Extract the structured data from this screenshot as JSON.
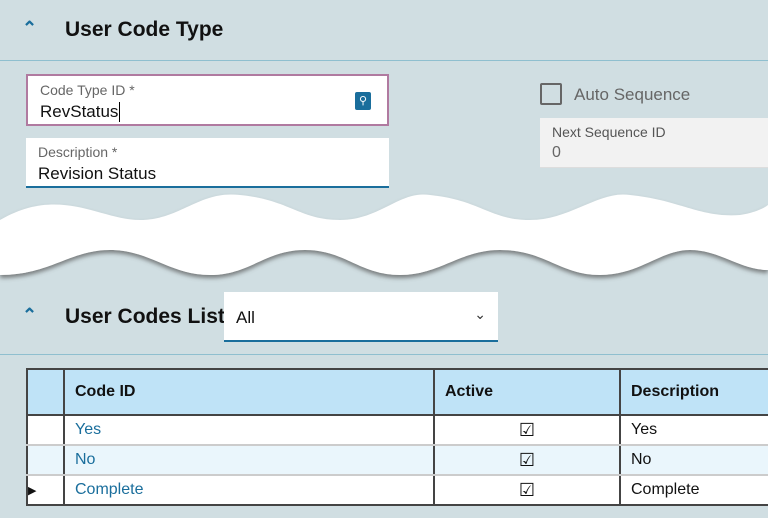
{
  "type_section": {
    "title": "User Code Type",
    "code_type_id": {
      "label": "Code Type ID *",
      "value": "RevStatus"
    },
    "description": {
      "label": "Description *",
      "value": "Revision Status"
    },
    "auto_sequence": {
      "label": "Auto Sequence",
      "checked": false
    },
    "next_sequence": {
      "label": "Next Sequence ID",
      "value": "0"
    }
  },
  "list_section": {
    "title": "User Codes List",
    "filter": "All",
    "columns": [
      "Code ID",
      "Active",
      "Description"
    ],
    "rows": [
      {
        "code_id": "Yes",
        "active": true,
        "description": "Yes"
      },
      {
        "code_id": "No",
        "active": true,
        "description": "No"
      },
      {
        "code_id": "Complete",
        "active": true,
        "description": "Complete"
      }
    ]
  },
  "icons": {
    "collapse": "chevron-up-icon",
    "lookup": "search-icon",
    "dropdown": "chevron-down-icon",
    "check": "checkbox-checked-icon",
    "row_pointer": "current-row-icon"
  },
  "colors": {
    "accent": "#1a6e9c",
    "focus_border": "#b07aa0",
    "header_bg": "#bfe3f7"
  }
}
